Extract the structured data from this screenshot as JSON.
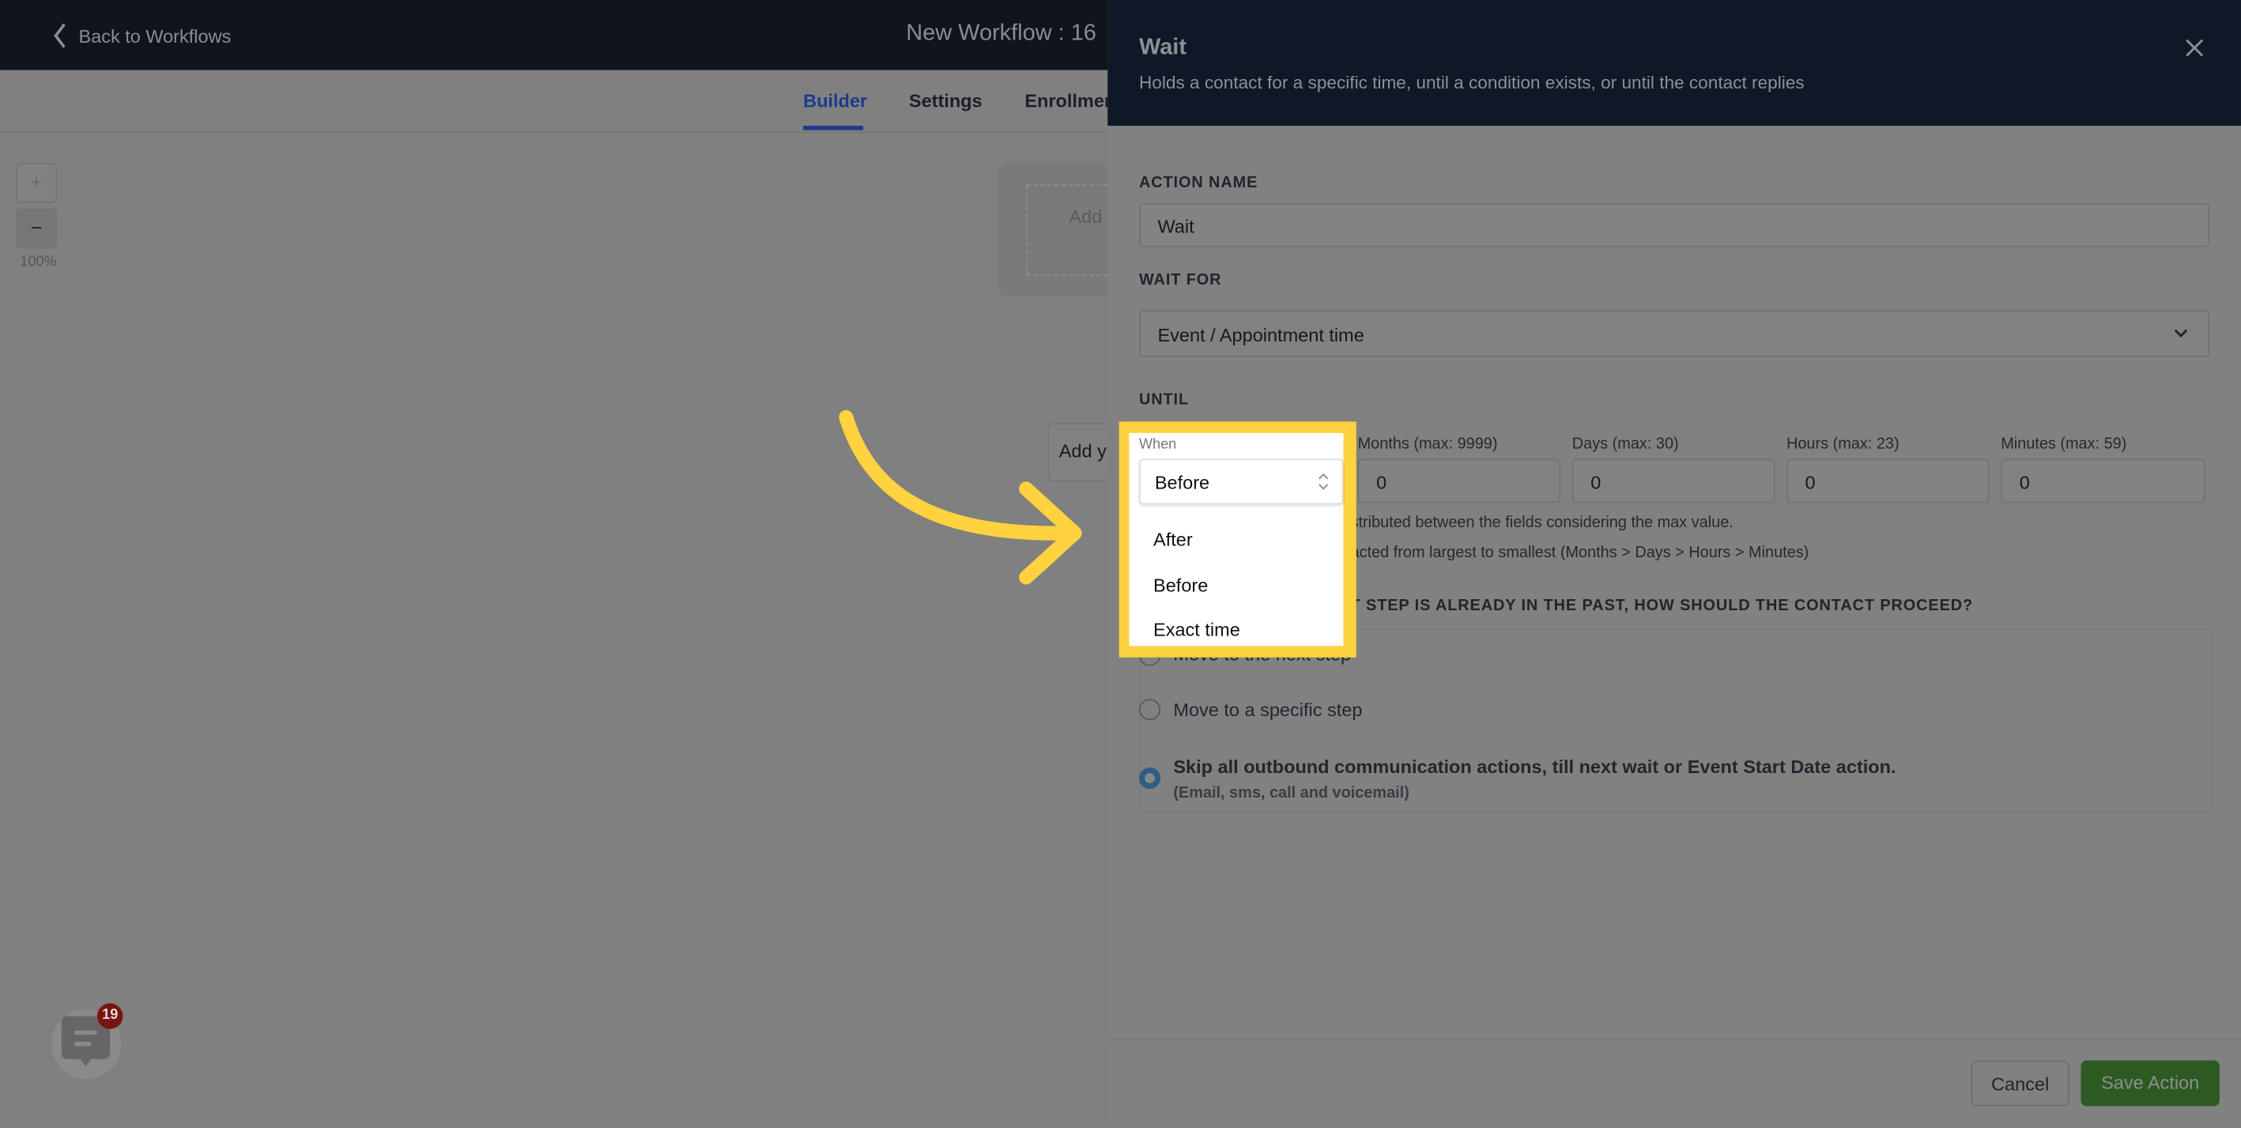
{
  "topbar": {
    "back_label": "Back to Workflows",
    "title": "New Workflow : 16"
  },
  "tabs": [
    {
      "label": "Builder",
      "active": true
    },
    {
      "label": "Settings"
    },
    {
      "label": "Enrollmen"
    }
  ],
  "canvas": {
    "zoom_in": "+",
    "zoom_out": "−",
    "zoom_level": "100%",
    "trigger_text": "Add",
    "action_text": "Add y"
  },
  "panel": {
    "title": "Wait",
    "subtitle": "Holds a contact for a specific time, until a condition exists, or until the contact replies",
    "action_name_label": "ACTION NAME",
    "action_name_value": "Wait",
    "wait_for_label": "WAIT FOR",
    "wait_for_value": "Event / Appointment time",
    "until_label": "UNTIL",
    "when_label": "When",
    "when_value": "Before",
    "when_options": [
      "After",
      "Before",
      "Exact time"
    ],
    "fields": [
      {
        "label": "Months (max: 9999)",
        "value": "0"
      },
      {
        "label": "Days (max: 30)",
        "value": "0"
      },
      {
        "label": "Hours (max: 23)",
        "value": "0"
      },
      {
        "label": "Minutes (max: 59)",
        "value": "0"
      }
    ],
    "help1": "stributed between the fields considering the max value.",
    "help2": "acted from largest to smallest (Months > Days > Hours > Minutes)",
    "question": "T STEP IS ALREADY IN THE PAST, HOW SHOULD THE CONTACT PROCEED?",
    "radios": [
      {
        "label": "Move to the next step",
        "selected": false
      },
      {
        "label": "Move to a specific step",
        "selected": false
      },
      {
        "label": "Skip all outbound communication actions, till next wait or Event Start Date action.",
        "sub": "(Email, sms, call and voicemail)",
        "selected": true
      }
    ],
    "cancel_label": "Cancel",
    "save_label": "Save Action"
  },
  "chat": {
    "badge": "19"
  },
  "colors": {
    "highlight": "#ffd23f",
    "save": "#2d5a23",
    "accent": "#1e3a8a",
    "badge": "#7a1410"
  }
}
